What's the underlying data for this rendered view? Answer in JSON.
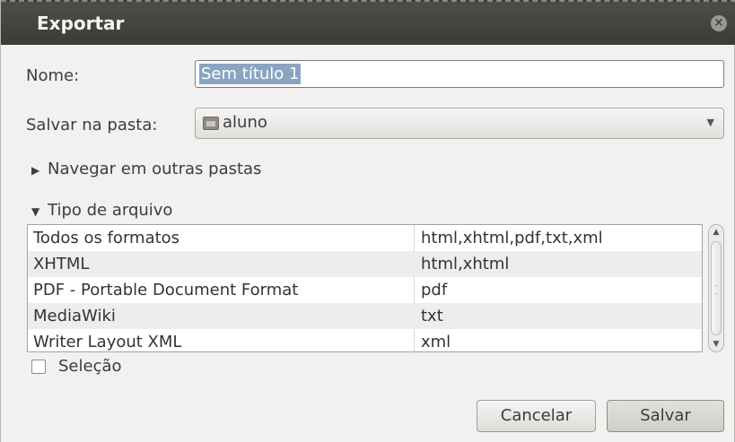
{
  "window": {
    "title": "Exportar",
    "close_glyph": "×"
  },
  "form": {
    "name_label": "Nome:",
    "name_value": "Sem título 1",
    "folder_label": "Salvar na pasta:",
    "folder_value": "aluno",
    "browse_expander": "Navegar em outras pastas",
    "filetype_expander": "Tipo de arquivo"
  },
  "filetypes": {
    "rows": [
      {
        "name": "Todos os formatos",
        "ext": "html,xhtml,pdf,txt,xml"
      },
      {
        "name": "XHTML",
        "ext": "html,xhtml"
      },
      {
        "name": "PDF - Portable Document Format",
        "ext": "pdf"
      },
      {
        "name": "MediaWiki",
        "ext": "txt"
      },
      {
        "name": "Writer Layout XML",
        "ext": "xml"
      }
    ]
  },
  "selection": {
    "label": "Seleção",
    "checked": false
  },
  "buttons": {
    "cancel": "Cancelar",
    "save": "Salvar"
  },
  "icons": {
    "close": "close-icon",
    "folder": "folder-icon",
    "combo_arrow": "chevron-down-icon",
    "expander_collapsed": "triangle-right-icon",
    "expander_expanded": "triangle-down-icon",
    "scroll_up": "scroll-up-arrow-icon",
    "scroll_down": "scroll-down-arrow-icon"
  },
  "colors": {
    "titlebar": "#3c3b37",
    "dialog_bg": "#f2f1f0",
    "selection_highlight": "#8aa4c2"
  }
}
